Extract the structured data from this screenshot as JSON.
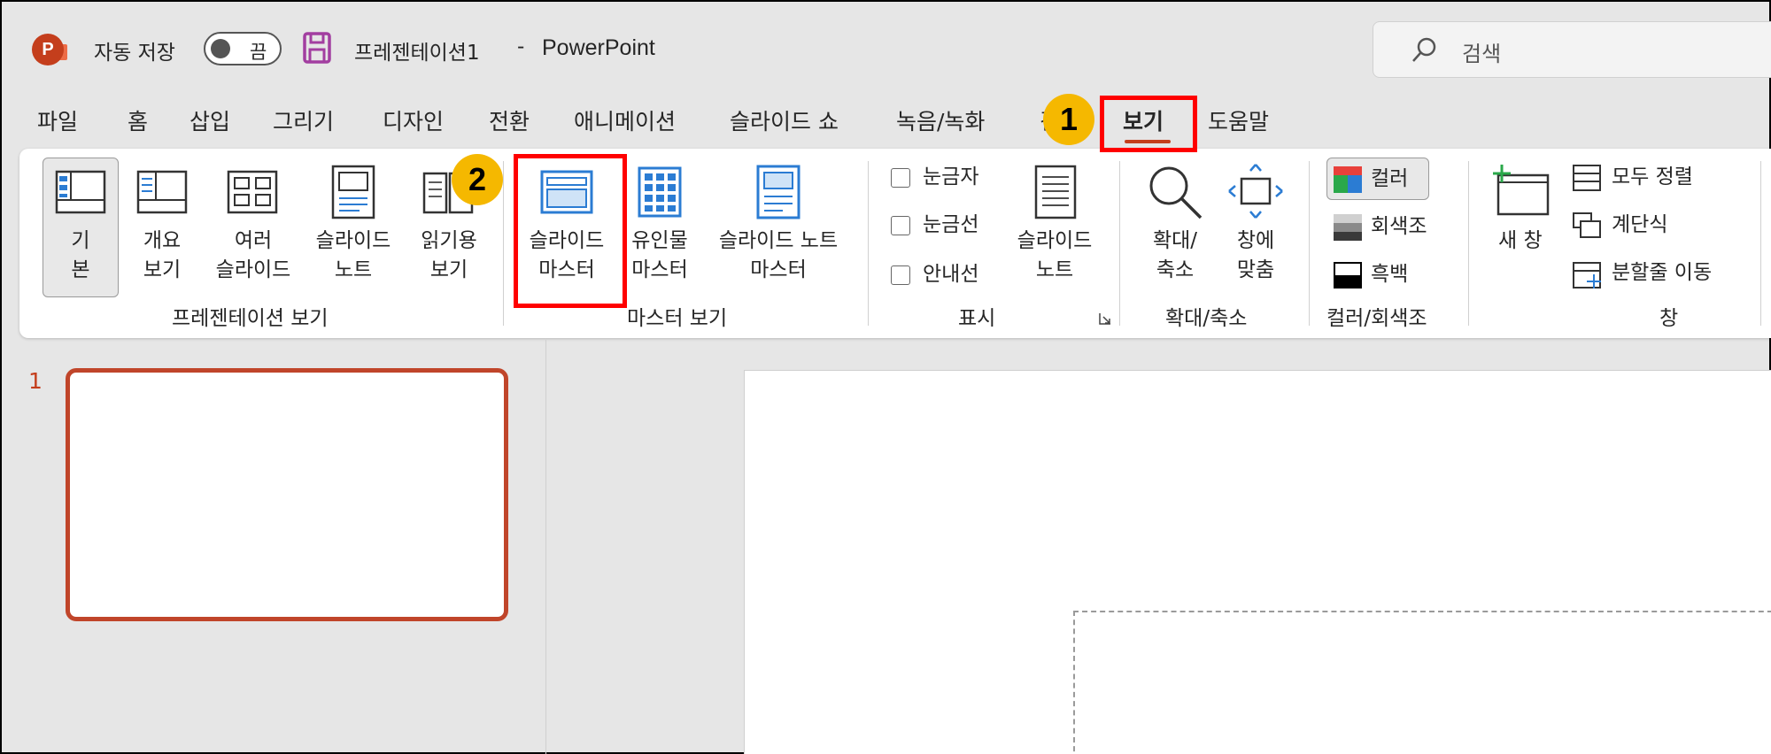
{
  "titlebar": {
    "app_logo_letter": "P",
    "autosave_label": "자동 저장",
    "autosave_state": "끔",
    "document_title": "프레젠테이션1",
    "title_separator": "-",
    "app_name": "PowerPoint",
    "search_placeholder": "검색"
  },
  "tabs": [
    {
      "label": "파일"
    },
    {
      "label": "홈"
    },
    {
      "label": "삽입"
    },
    {
      "label": "그리기"
    },
    {
      "label": "디자인"
    },
    {
      "label": "전환"
    },
    {
      "label": "애니메이션"
    },
    {
      "label": "슬라이드 쇼"
    },
    {
      "label": "녹음/녹화"
    },
    {
      "label": "검"
    },
    {
      "label": "보기",
      "active": true
    },
    {
      "label": "도움말"
    }
  ],
  "ribbon": {
    "presentation_views": {
      "group_label": "프레젠테이션 보기",
      "normal": [
        "기",
        "본"
      ],
      "outline": [
        "개요",
        "보기"
      ],
      "slide_sorter": [
        "여러",
        "슬라이드"
      ],
      "notes_page": [
        "슬라이드",
        "노트"
      ],
      "reading_view": [
        "읽기용",
        "보기"
      ]
    },
    "master_views": {
      "group_label": "마스터 보기",
      "slide_master": [
        "슬라이드",
        "마스터"
      ],
      "handout_master": [
        "유인물",
        "마스터"
      ],
      "notes_master": [
        "슬라이드 노트",
        "마스터"
      ]
    },
    "show": {
      "group_label": "표시",
      "ruler": "눈금자",
      "gridlines": "눈금선",
      "guides": "안내선",
      "notes": [
        "슬라이드",
        "노트"
      ]
    },
    "zoom": {
      "group_label": "확대/축소",
      "zoom": [
        "확대/",
        "축소"
      ],
      "fit_to_window": [
        "창에",
        "맞춤"
      ]
    },
    "color_grayscale": {
      "group_label": "컬러/회색조",
      "color": "컬러",
      "grayscale": "회색조",
      "black_white": "흑백"
    },
    "window": {
      "group_label": "창",
      "new_window": "새 창",
      "arrange_all": "모두 정렬",
      "cascade": "계단식",
      "move_split": "분할줄 이동"
    }
  },
  "callouts": {
    "step1": "1",
    "step2": "2"
  },
  "slides_pane": {
    "slide_number": "1"
  },
  "colors": {
    "accent": "#c43e1c",
    "callout_box": "#ff0000",
    "badge": "#f5b800"
  }
}
